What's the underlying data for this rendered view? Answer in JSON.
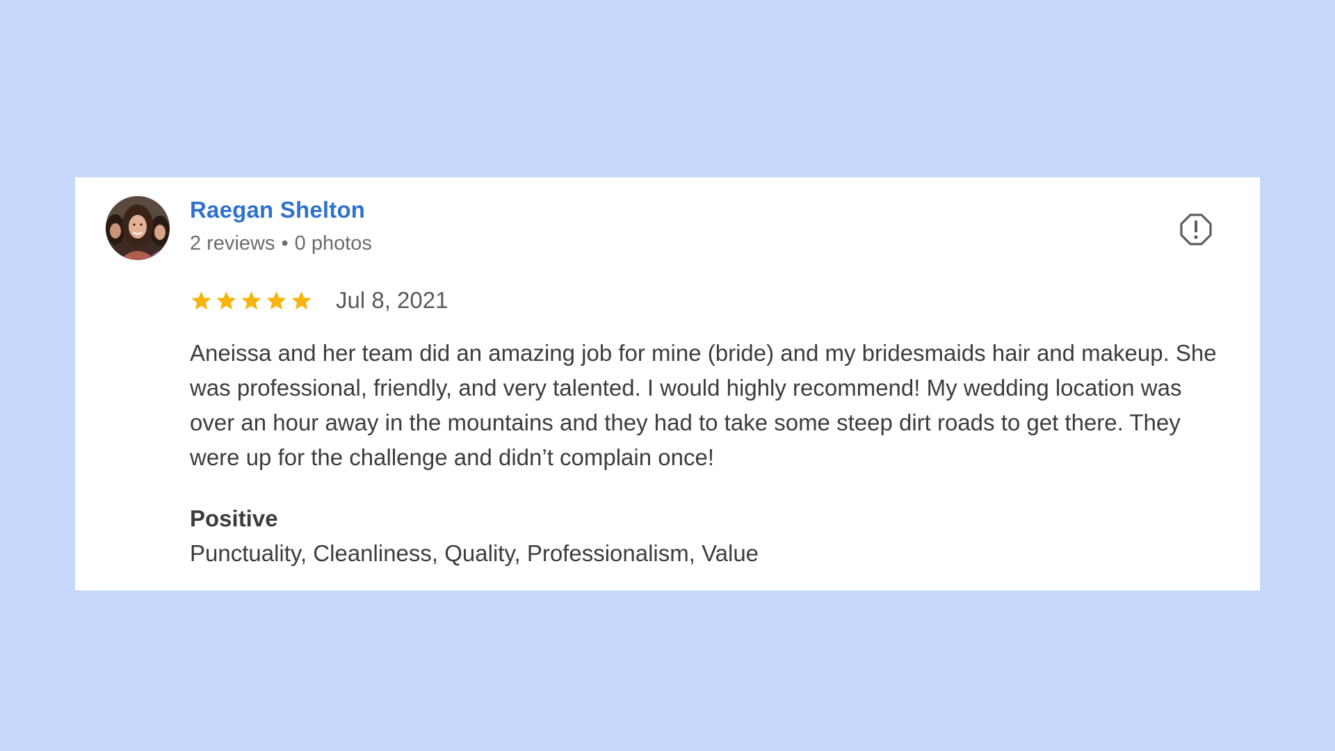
{
  "review": {
    "reviewer": {
      "name": "Raegan Shelton",
      "review_count": "2 reviews",
      "separator": "•",
      "photo_count": "0 photos"
    },
    "rating": {
      "value": 5,
      "max": 5,
      "star_color": "#f5b50c"
    },
    "date": "Jul 8, 2021",
    "text": "Aneissa and her team did an amazing job for mine (bride) and my bridesmaids hair and makeup. She was professional, friendly, and very talented. I would highly recommend! My wedding location was over an hour away in the mountains and they had to take some steep dirt roads to get there. They were up for the challenge and didn’t complain once!",
    "attributes": {
      "heading": "Positive",
      "values": "Punctuality, Cleanliness, Quality, Professionalism, Value"
    },
    "actions": {
      "flag_icon": "report-flag-icon"
    }
  },
  "colors": {
    "background": "#c6d8fc",
    "card": "#ffffff",
    "name_link": "#2f72cc",
    "meta_text": "#6b6b6b",
    "body_text": "#3c3c3c"
  }
}
